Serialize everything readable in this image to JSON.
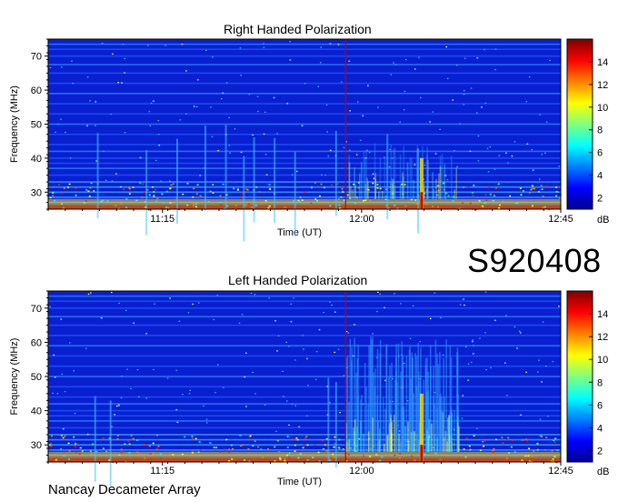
{
  "chart_data": [
    {
      "type": "heatmap",
      "title": "Right Handed Polarization",
      "xlabel": "Time (UT)",
      "ylabel": "Frequency (MHz)",
      "x_ticks": [
        "11:15",
        "12:00",
        "12:45"
      ],
      "y_ticks": [
        30,
        40,
        50,
        60,
        70
      ],
      "ylim": [
        25,
        75
      ],
      "colorbar": {
        "unit": "dB",
        "ticks": [
          2,
          4,
          6,
          8,
          10,
          12,
          14
        ],
        "range": [
          1,
          16
        ]
      },
      "colormap": [
        "#00008f",
        "#0000ff",
        "#0080ff",
        "#00ffff",
        "#80ff80",
        "#ffff00",
        "#ff8000",
        "#ff0000",
        "#800000"
      ]
    },
    {
      "type": "heatmap",
      "title": "Left Handed Polarization",
      "xlabel": "Time (UT)",
      "ylabel": "Frequency (MHz)",
      "x_ticks": [
        "11:15",
        "12:00",
        "12:45"
      ],
      "y_ticks": [
        30,
        40,
        50,
        60,
        70
      ],
      "ylim": [
        25,
        75
      ],
      "colorbar": {
        "unit": "dB",
        "ticks": [
          2,
          4,
          6,
          8,
          10,
          12,
          14
        ],
        "range": [
          1,
          16
        ]
      },
      "colormap": [
        "#00008f",
        "#0000ff",
        "#0080ff",
        "#00ffff",
        "#80ff80",
        "#ffff00",
        "#ff8000",
        "#ff0000",
        "#800000"
      ]
    }
  ],
  "observation_id": "S920408",
  "footer": "Nancay Decameter Array"
}
